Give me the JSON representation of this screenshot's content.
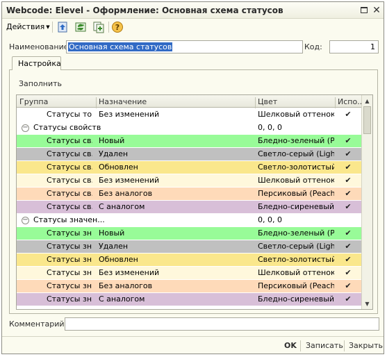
{
  "window": {
    "title": "Webcode: Elevel - Оформление: Основная схема статусов"
  },
  "toolbar": {
    "actions_label": "Действия"
  },
  "form": {
    "name_label": "Наименование:",
    "name_value": "Основная схема статусов",
    "code_label": "Код:",
    "code_value": "1",
    "comment_label": "Комментарий:",
    "comment_value": ""
  },
  "tabs": [
    {
      "label": "Настройка"
    }
  ],
  "panel": {
    "fill_label": "Заполнить"
  },
  "grid": {
    "columns": [
      "Группа",
      "Назначение",
      "Цвет",
      "Испо..."
    ],
    "rows": [
      {
        "kind": "item",
        "group": "Статусы то...",
        "dest": "Без изменений",
        "color": "Шелковый оттенок ...",
        "use": true,
        "bg": "#ffffff"
      },
      {
        "kind": "group",
        "group": "Статусы свойств",
        "color": "0, 0, 0",
        "bg": "#ffffff"
      },
      {
        "kind": "item",
        "group": "Статусы св...",
        "dest": "Новый",
        "color": "Бледно-зеленый (P...",
        "use": true,
        "bg": "#98fb98"
      },
      {
        "kind": "item",
        "group": "Статусы св...",
        "dest": "Удален",
        "color": "Светло-серый (Ligh...",
        "use": true,
        "bg": "#c0c0c0"
      },
      {
        "kind": "item",
        "group": "Статусы св...",
        "dest": "Обновлен",
        "color": "Светло-золотистый...",
        "use": true,
        "bg": "#fae78c"
      },
      {
        "kind": "item",
        "group": "Статусы св...",
        "dest": "Без изменений",
        "color": "Шелковый оттенок ...",
        "use": true,
        "bg": "#fff8dc"
      },
      {
        "kind": "item",
        "group": "Статусы св...",
        "dest": "Без аналогов",
        "color": "Персиковый (Peach...",
        "use": true,
        "bg": "#fedab9"
      },
      {
        "kind": "item",
        "group": "Статусы св...",
        "dest": "С аналогом",
        "color": "Бледно-сиреневый ...",
        "use": true,
        "bg": "#d8bfd8"
      },
      {
        "kind": "group",
        "group": "Статусы значен...",
        "color": "0, 0, 0",
        "bg": "#ffffff"
      },
      {
        "kind": "item",
        "group": "Статусы зн...",
        "dest": "Новый",
        "color": "Бледно-зеленый (P...",
        "use": true,
        "bg": "#98fb98"
      },
      {
        "kind": "item",
        "group": "Статусы зн...",
        "dest": "Удален",
        "color": "Светло-серый (Ligh...",
        "use": true,
        "bg": "#c0c0c0"
      },
      {
        "kind": "item",
        "group": "Статусы зн...",
        "dest": "Обновлен",
        "color": "Светло-золотистый...",
        "use": true,
        "bg": "#fae78c"
      },
      {
        "kind": "item",
        "group": "Статусы зн...",
        "dest": "Без изменений",
        "color": "Шелковый оттенок ...",
        "use": true,
        "bg": "#fff8dc"
      },
      {
        "kind": "item",
        "group": "Статусы зн...",
        "dest": "Без аналогов",
        "color": "Персиковый (Peach...",
        "use": true,
        "bg": "#fedab9"
      },
      {
        "kind": "item",
        "group": "Статусы зн...",
        "dest": "С аналогом",
        "color": "Бледно-сиреневый ...",
        "use": true,
        "bg": "#d8bfd8"
      }
    ]
  },
  "footer": {
    "ok_label": "OK",
    "save_label": "Записать",
    "close_label": "Закрыть"
  },
  "icons": [
    "go-up-icon",
    "refresh-icon",
    "copy-icon",
    "help-icon"
  ],
  "colors": {
    "selection": "#316ac5",
    "window_bg": "#fbfbef"
  }
}
